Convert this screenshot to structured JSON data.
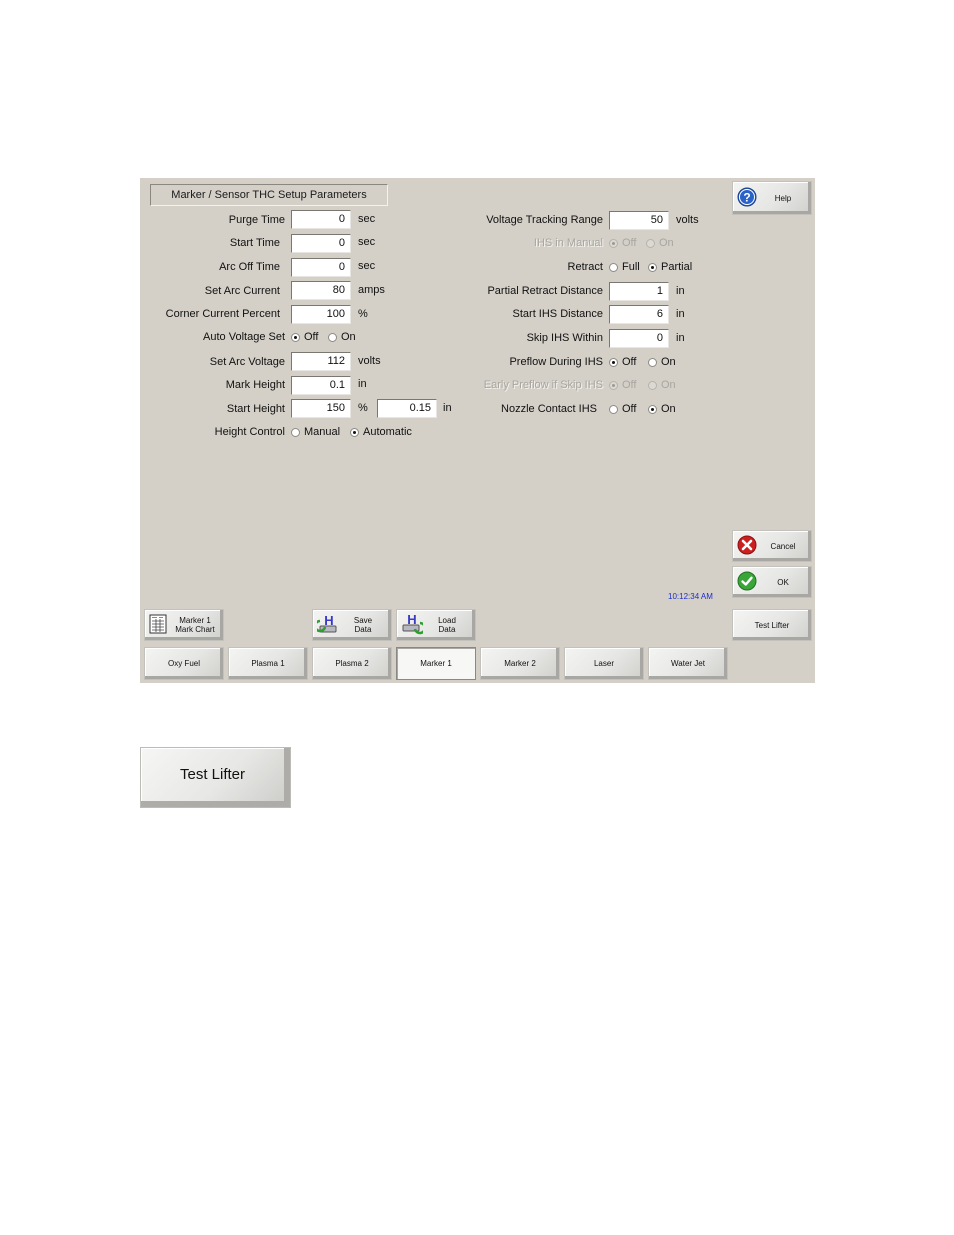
{
  "window": {
    "title": "Marker / Sensor THC Setup Parameters",
    "clock": "10:12:34 AM"
  },
  "left_params": [
    {
      "label": "Purge Time",
      "value": "0",
      "unit": "sec"
    },
    {
      "label": "Start Time",
      "value": "0",
      "unit": "sec"
    },
    {
      "label": "Arc Off Time",
      "value": "0",
      "unit": "sec"
    },
    {
      "label": "Set Arc Current",
      "value": "80",
      "unit": "amps"
    },
    {
      "label": "Corner Current Percent",
      "value": "100",
      "unit": "%"
    }
  ],
  "auto_voltage_set": {
    "label": "Auto Voltage Set",
    "options": [
      "Off",
      "On"
    ],
    "selected": "Off"
  },
  "left_params_2": [
    {
      "label": "Set Arc Voltage",
      "value": "112",
      "unit": "volts"
    },
    {
      "label": "Mark Height",
      "value": "0.1",
      "unit": "in"
    }
  ],
  "start_height": {
    "label": "Start Height",
    "value": "150",
    "unit": "%",
    "value2": "0.15",
    "unit2": "in"
  },
  "height_control": {
    "label": "Height Control",
    "options": [
      "Manual",
      "Automatic"
    ],
    "selected": "Automatic"
  },
  "right_params": {
    "voltage_tracking_range": {
      "label": "Voltage Tracking Range",
      "value": "50",
      "unit": "volts"
    },
    "ihs_in_manual": {
      "label": "IHS in Manual",
      "options": [
        "Off",
        "On"
      ],
      "selected": "Off",
      "disabled": true
    },
    "retract": {
      "label": "Retract",
      "options": [
        "Full",
        "Partial"
      ],
      "selected": "Partial"
    },
    "partial_retract_distance": {
      "label": "Partial Retract Distance",
      "value": "1",
      "unit": "in"
    },
    "start_ihs_distance": {
      "label": "Start IHS Distance",
      "value": "6",
      "unit": "in"
    },
    "skip_ihs_within": {
      "label": "Skip IHS Within",
      "value": "0",
      "unit": "in"
    },
    "preflow_during_ihs": {
      "label": "Preflow During IHS",
      "options": [
        "Off",
        "On"
      ],
      "selected": "Off"
    },
    "early_preflow": {
      "label": "Early Preflow if Skip IHS",
      "options": [
        "Off",
        "On"
      ],
      "selected": "Off",
      "disabled": true
    },
    "nozzle_contact_ihs": {
      "label": "Nozzle Contact IHS",
      "options": [
        "Off",
        "On"
      ],
      "selected": "On"
    }
  },
  "side_buttons": {
    "help": "Help",
    "cancel": "Cancel",
    "ok": "OK",
    "test_lifter": "Test Lifter"
  },
  "action_buttons": {
    "mark_chart_line1": "Marker 1",
    "mark_chart_line2": "Mark Chart",
    "save_line1": "Save",
    "save_line2": "Data",
    "load_line1": "Load",
    "load_line2": "Data"
  },
  "process_tabs": [
    "Oxy Fuel",
    "Plasma 1",
    "Plasma 2",
    "Marker 1",
    "Marker 2",
    "Laser",
    "Water Jet"
  ],
  "selected_tab": "Marker 1",
  "enlarged_button": {
    "label": "Test Lifter"
  },
  "colors": {
    "panel_bg": "#d4d0c8",
    "clock_text": "#1a2ecc",
    "help_icon": "#2a62c8",
    "cancel_icon": "#cc1f1f",
    "ok_icon": "#3aa63a"
  }
}
